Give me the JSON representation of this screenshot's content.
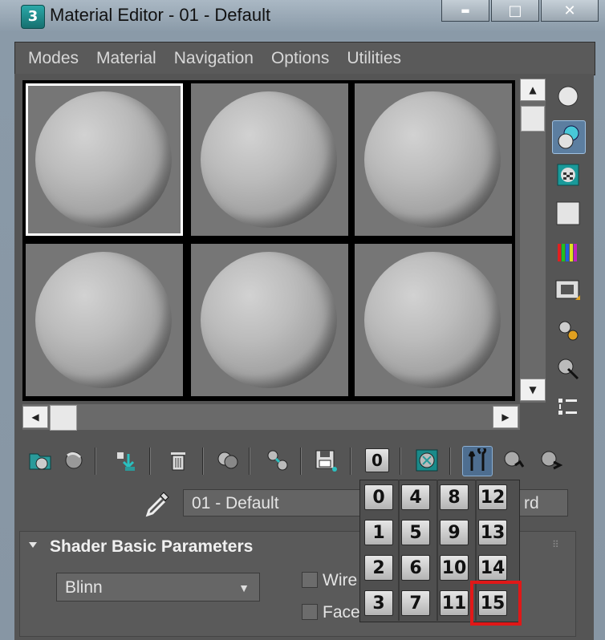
{
  "window": {
    "app_icon_text": "3",
    "title": "Material Editor - 01 - Default",
    "minimize_glyph": "▬",
    "maximize_glyph": "□",
    "close_glyph": "✕"
  },
  "menu": [
    "Modes",
    "Material",
    "Navigation",
    "Options",
    "Utilities"
  ],
  "sample_slots": {
    "count": 6,
    "active_index": 0
  },
  "material_name": "01 - Default",
  "material_type_partial": "rd",
  "rollout": {
    "title": "Shader Basic Parameters",
    "shader": "Blinn",
    "checkbox_wire": "Wire",
    "checkbox_face": "Face",
    "wire_checked": false,
    "face_checked": false
  },
  "toolbar_bottom": {
    "material_id_channel": "0"
  },
  "channel_popup": {
    "columns": [
      [
        "0",
        "1",
        "2",
        "3"
      ],
      [
        "4",
        "5",
        "6",
        "7"
      ],
      [
        "8",
        "9",
        "10",
        "11"
      ],
      [
        "12",
        "13",
        "14",
        "15"
      ]
    ],
    "highlighted": "15"
  },
  "colors": {
    "highlight": "#e01818",
    "selected_tool": "#5c7ea0"
  }
}
